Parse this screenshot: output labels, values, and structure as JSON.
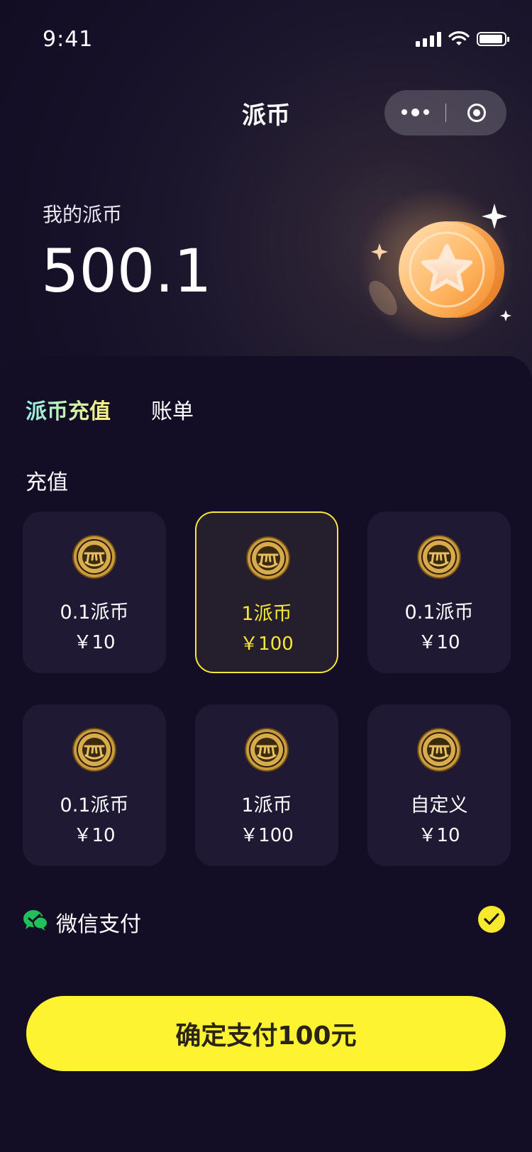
{
  "status_bar": {
    "time": "9:41"
  },
  "nav": {
    "title": "派币"
  },
  "balance": {
    "label": "我的派币",
    "value": "500.1"
  },
  "tabs": [
    {
      "label": "派币充值",
      "active": true
    },
    {
      "label": "账单",
      "active": false
    }
  ],
  "section": {
    "title": "充值"
  },
  "packages": [
    {
      "amount": "0.1派币",
      "price": "￥10",
      "selected": false
    },
    {
      "amount": "1派币",
      "price": "￥100",
      "selected": true
    },
    {
      "amount": "0.1派币",
      "price": "￥10",
      "selected": false
    },
    {
      "amount": "0.1派币",
      "price": "￥10",
      "selected": false
    },
    {
      "amount": "1派币",
      "price": "￥100",
      "selected": false
    },
    {
      "amount": "自定义",
      "price": "￥10",
      "selected": false
    }
  ],
  "payment": {
    "method": "微信支付",
    "icon": "wechat-icon",
    "checked": true
  },
  "confirm": {
    "label": "确定支付100元"
  },
  "colors": {
    "accent": "#fef330",
    "background": "#140d26",
    "card": "#1f1934",
    "wechat": "#22c05a"
  }
}
